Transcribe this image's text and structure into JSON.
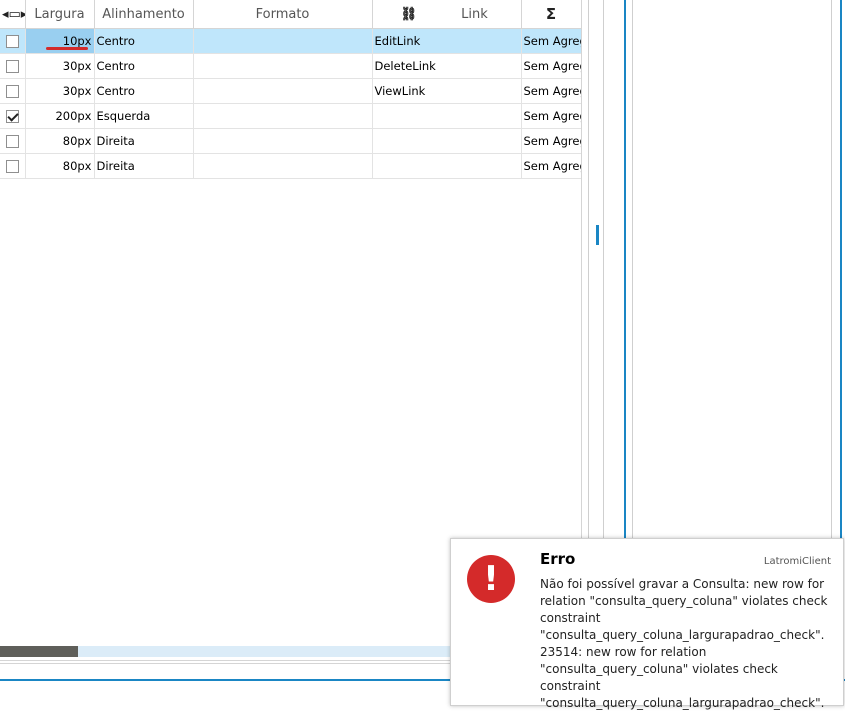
{
  "grid": {
    "headers": {
      "resize_glyph": "◂▭▸",
      "largura": "Largura",
      "alinhamento": "Alinhamento",
      "formato": "Formato",
      "link_glyph": "⛓",
      "link": "Link",
      "sigma": "Σ"
    },
    "rows": [
      {
        "checked": false,
        "largura": "10px",
        "alinhamento": "Centro",
        "formato": "",
        "link": "EditLink",
        "agregacao": "Sem Agreg"
      },
      {
        "checked": false,
        "largura": "30px",
        "alinhamento": "Centro",
        "formato": "",
        "link": "DeleteLink",
        "agregacao": "Sem Agreg"
      },
      {
        "checked": false,
        "largura": "30px",
        "alinhamento": "Centro",
        "formato": "",
        "link": "ViewLink",
        "agregacao": "Sem Agreg"
      },
      {
        "checked": true,
        "largura": "200px",
        "alinhamento": "Esquerda",
        "formato": "",
        "link": "",
        "agregacao": "Sem Agreg"
      },
      {
        "checked": false,
        "largura": "80px",
        "alinhamento": "Direita",
        "formato": "",
        "link": "",
        "agregacao": "Sem Agreg"
      },
      {
        "checked": false,
        "largura": "80px",
        "alinhamento": "Direita",
        "formato": "",
        "link": "",
        "agregacao": "Sem Agreg"
      }
    ]
  },
  "toast": {
    "title": "Erro",
    "app": "LatromiClient",
    "icon_glyph": "!",
    "message": "Não foi possível gravar a Consulta: new row for relation \"consulta_query_coluna\" violates check constraint \"consulta_query_coluna_largurapadrao_check\". 23514: new row for relation \"consulta_query_coluna\" violates check constraint \"consulta_query_coluna_largurapadrao_check\"."
  },
  "colors": {
    "accent": "#1a86c4",
    "selection": "#bfe6fb",
    "error": "#d42a2a"
  }
}
